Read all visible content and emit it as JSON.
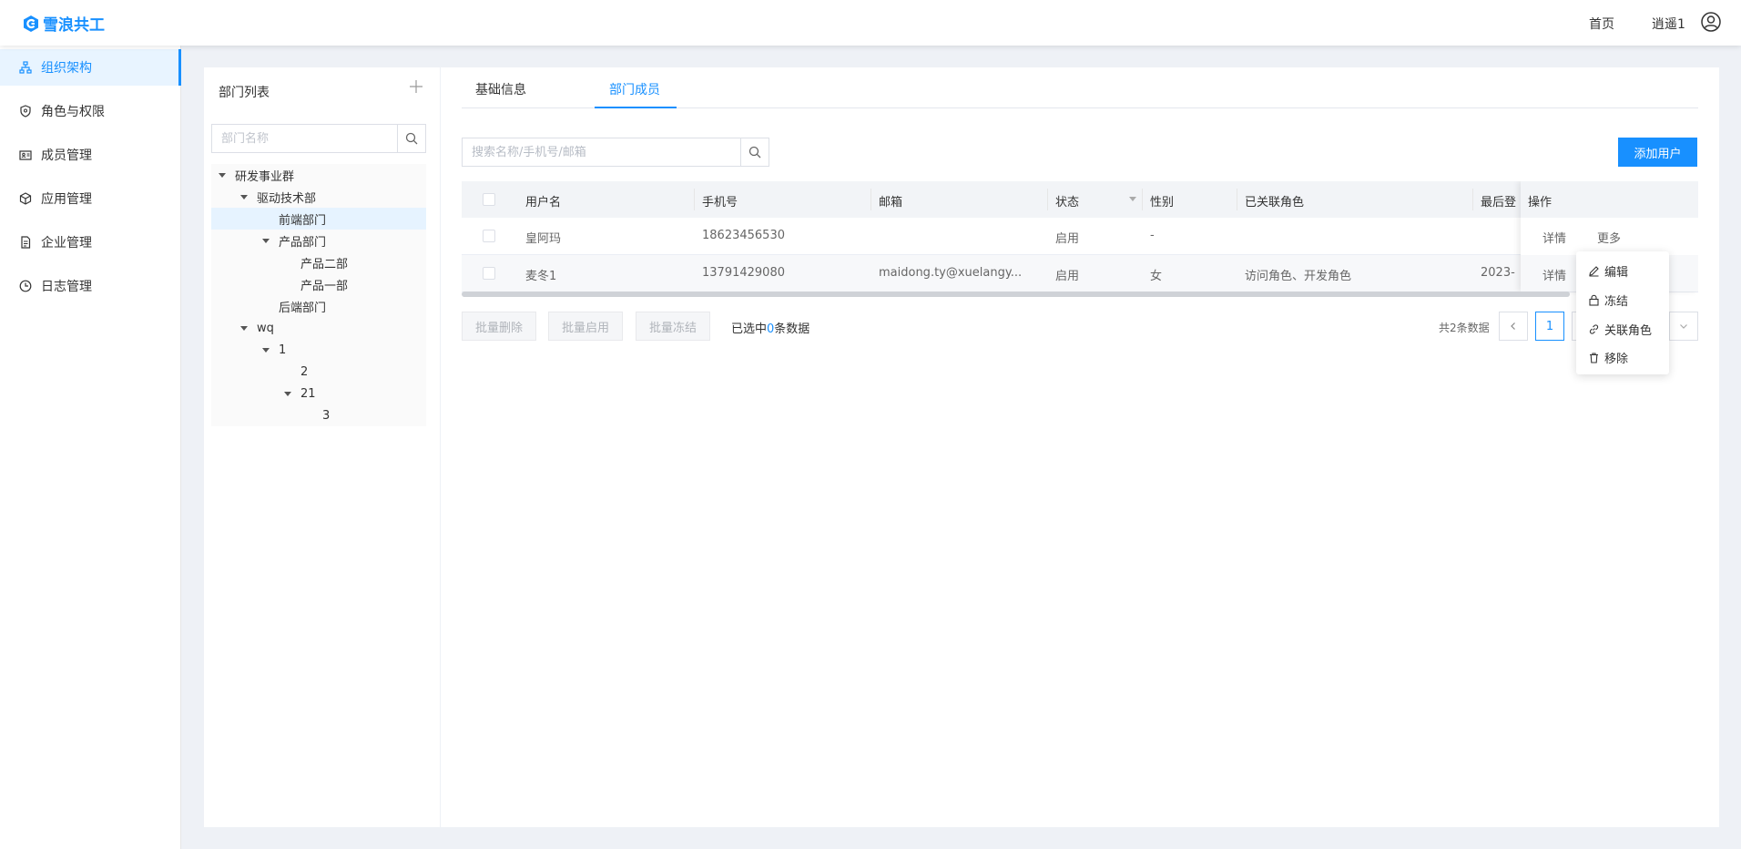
{
  "app": {
    "logo_text": "雪浪共工"
  },
  "topnav": {
    "home": "首页",
    "user": "逍遥1"
  },
  "sidebar": {
    "items": [
      {
        "label": "组织架构",
        "icon": "org-chart-icon",
        "active": true
      },
      {
        "label": "角色与权限",
        "icon": "shield-icon"
      },
      {
        "label": "成员管理",
        "icon": "id-card-icon"
      },
      {
        "label": "应用管理",
        "icon": "cube-icon"
      },
      {
        "label": "企业管理",
        "icon": "document-icon"
      },
      {
        "label": "日志管理",
        "icon": "clock-icon"
      }
    ]
  },
  "dept_tree": {
    "title": "部门列表",
    "search_placeholder": "部门名称",
    "nodes": [
      {
        "label": "研发事业群",
        "depth": 0,
        "expanded": true
      },
      {
        "label": "驱动技术部",
        "depth": 1,
        "expanded": true
      },
      {
        "label": "前端部门",
        "depth": 2,
        "leaf": true,
        "selected": true
      },
      {
        "label": "产品部门",
        "depth": 2,
        "expanded": true
      },
      {
        "label": "产品二部",
        "depth": 3,
        "leaf": true
      },
      {
        "label": "产品一部",
        "depth": 3,
        "leaf": true
      },
      {
        "label": "后端部门",
        "depth": 2,
        "leaf": true
      },
      {
        "label": "wq",
        "depth": 1,
        "expanded": true
      },
      {
        "label": "1",
        "depth": 2,
        "expanded": true
      },
      {
        "label": "2",
        "depth": 3,
        "leaf": true
      },
      {
        "label": "21",
        "depth": 3,
        "expanded": true
      },
      {
        "label": "3",
        "depth": 4,
        "leaf": true
      }
    ]
  },
  "tabs": [
    {
      "label": "基础信息"
    },
    {
      "label": "部门成员",
      "active": true
    }
  ],
  "members": {
    "search_placeholder": "搜索名称/手机号/邮箱",
    "add_button": "添加用户",
    "columns": {
      "username": "用户名",
      "phone": "手机号",
      "email": "邮箱",
      "status": "状态",
      "gender": "性别",
      "roles": "已关联角色",
      "last_login": "最后登",
      "actions": "操作"
    },
    "rows": [
      {
        "username": "皇阿玛",
        "phone": "18623456530",
        "email": "",
        "status": "启用",
        "gender": "-",
        "roles": "",
        "last_login": "",
        "detail": "详情",
        "more": "更多"
      },
      {
        "username": "麦冬1",
        "phone": "13791429080",
        "email": "maidong.ty@xuelangy...",
        "status": "启用",
        "gender": "女",
        "roles": "访问角色、开发角色",
        "last_login": "2023-",
        "detail": "详情",
        "more": ""
      }
    ],
    "bulk": {
      "delete": "批量删除",
      "enable": "批量启用",
      "freeze": "批量冻结"
    },
    "selection": {
      "prefix": "已选中",
      "count": "0",
      "suffix": "条数据"
    },
    "pagination": {
      "total": "共2条数据",
      "current": "1"
    }
  },
  "more_menu": {
    "items": [
      {
        "label": "编辑",
        "icon": "edit-icon"
      },
      {
        "label": "冻结",
        "icon": "lock-icon"
      },
      {
        "label": "关联角色",
        "icon": "link-icon"
      },
      {
        "label": "移除",
        "icon": "trash-icon"
      }
    ]
  },
  "colors": {
    "primary": "#1890ff"
  }
}
